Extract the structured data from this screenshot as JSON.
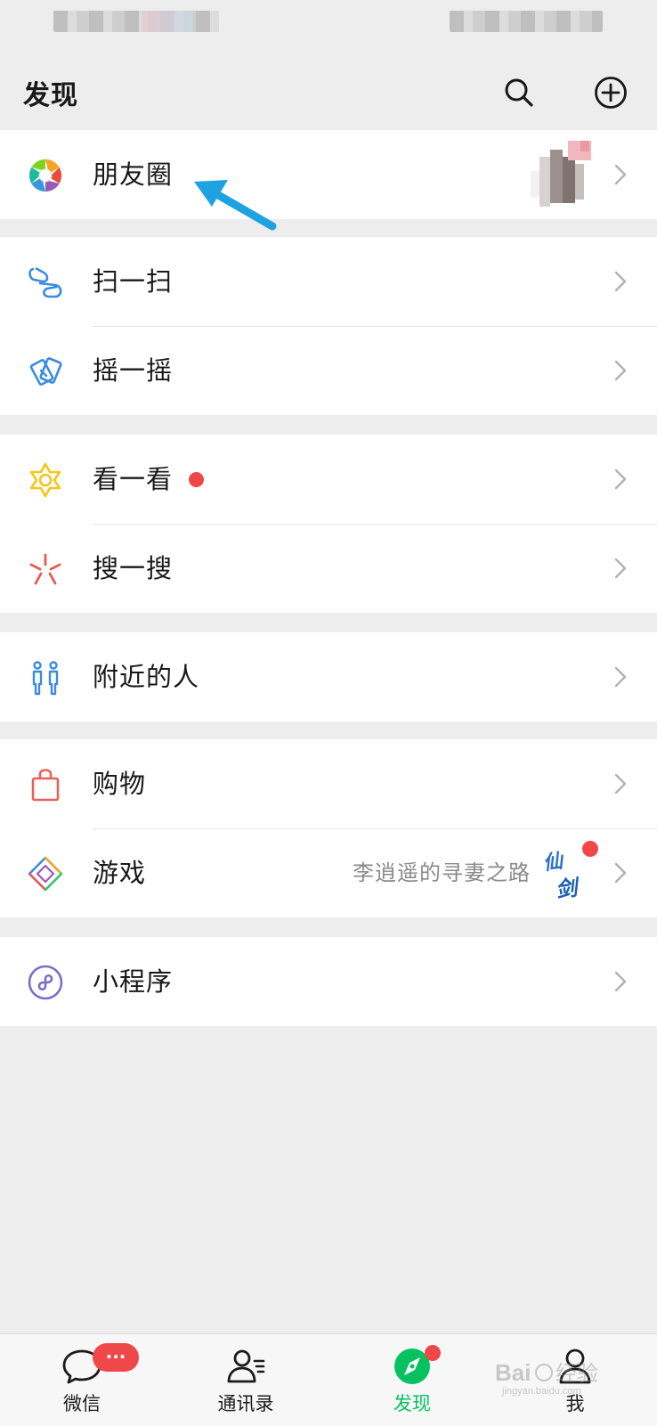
{
  "header": {
    "title": "发现",
    "search_icon": "search-icon",
    "add_icon": "plus-circle-icon"
  },
  "cells": {
    "moments": {
      "label": "朋友圈",
      "icon": "moments-aperture-icon"
    },
    "scan": {
      "label": "扫一扫",
      "icon": "scan-icon"
    },
    "shake": {
      "label": "摇一摇",
      "icon": "shake-icon"
    },
    "top_stories": {
      "label": "看一看",
      "icon": "top-stories-icon",
      "has_red_dot": true
    },
    "search": {
      "label": "搜一搜",
      "icon": "search-sparkle-icon"
    },
    "nearby": {
      "label": "附近的人",
      "icon": "people-nearby-icon"
    },
    "shopping": {
      "label": "购物",
      "icon": "shopping-bag-icon"
    },
    "games": {
      "label": "游戏",
      "icon": "games-diamond-icon",
      "detail": "李逍遥的寻妻之路",
      "logo_text": "仙剑",
      "has_red_dot": true
    },
    "mini_programs": {
      "label": "小程序",
      "icon": "mini-programs-icon"
    }
  },
  "tabbar": {
    "tabs": [
      {
        "label": "微信",
        "icon": "chat-bubble-icon",
        "badge": "···"
      },
      {
        "label": "通讯录",
        "icon": "contacts-icon"
      },
      {
        "label": "发现",
        "icon": "compass-icon",
        "active": true,
        "has_red_dot": true
      },
      {
        "label": "我",
        "icon": "person-icon"
      }
    ]
  },
  "colors": {
    "accent_green": "#07c160",
    "badge_red": "#f04848",
    "annotation_arrow": "#1fa2e0",
    "background": "#ededed"
  },
  "watermark": {
    "text": "Baidu经验",
    "subtext": "jingyan.baidu.com"
  }
}
